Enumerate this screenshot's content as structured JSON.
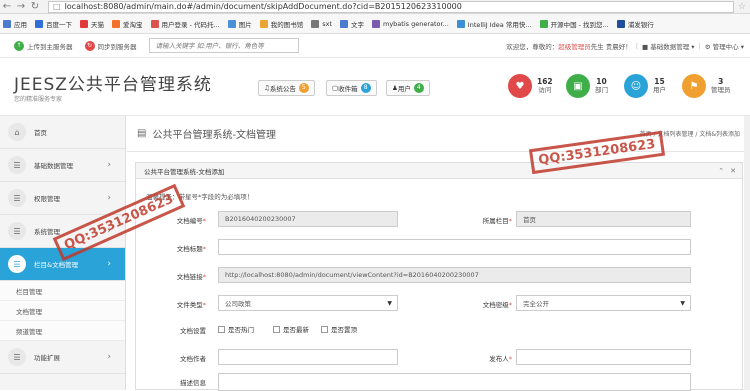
{
  "browser": {
    "url": "localhost:8080/admin/main.do#/admin/document/skipAddDocument.do?cid=B2015120623310000",
    "bookmarks": [
      {
        "label": "应用",
        "color": "#4a7bd0"
      },
      {
        "label": "百度一下",
        "color": "#2f6fd6"
      },
      {
        "label": "天猫",
        "color": "#e23a3a"
      },
      {
        "label": "爱淘宝",
        "color": "#f2722b"
      },
      {
        "label": "用户登录 - 代码托...",
        "color": "#d9534f"
      },
      {
        "label": "图片",
        "color": "#4a90d9"
      },
      {
        "label": "我的图书馆",
        "color": "#e8a533"
      },
      {
        "label": "sxt",
        "color": "#777777"
      },
      {
        "label": "文字",
        "color": "#4a7bd0"
      },
      {
        "label": "mybatis generator...",
        "color": "#7b5bb0"
      },
      {
        "label": "IntelliJ Idea 常用快...",
        "color": "#3b8fd6"
      },
      {
        "label": "开源中国 - 找到您...",
        "color": "#3fae49"
      },
      {
        "label": "浦发银行",
        "color": "#1d4f9c"
      }
    ]
  },
  "topbar": {
    "upload_label": "上传到主服务器",
    "sync_label": "同步到服务器",
    "search_placeholder": "请输入关键字 如:用户、银行、角色等",
    "welcome_prefix": "欢迎您，尊敬的：",
    "admin_name": "超级管理员",
    "welcome_suffix": "先生 贵晨好！",
    "basic_mgmt": "基础数据管理",
    "mgmt_center": "管理中心"
  },
  "header": {
    "logo": "JEESZ公共平台管理系统",
    "subtitle": "您的精准服务专家",
    "notice_label": "系统公告",
    "notice_count": "5",
    "inbox_label": "收件箱",
    "inbox_count": "8",
    "user_label": "用户",
    "user_count": "4",
    "stats": [
      {
        "value": "162",
        "label": "访问",
        "color": "#e0484a",
        "icon": "activity-icon"
      },
      {
        "value": "10",
        "label": "部门",
        "color": "#3fae49",
        "icon": "money-icon"
      },
      {
        "value": "15",
        "label": "用户",
        "color": "#2aa3d9",
        "icon": "users-icon"
      },
      {
        "value": "3",
        "label": "管理员",
        "color": "#f0a030",
        "icon": "admin-icon"
      }
    ]
  },
  "sidebar": {
    "items": [
      {
        "label": "首页"
      },
      {
        "label": "基础数据管理"
      },
      {
        "label": "权限管理"
      },
      {
        "label": "系统管理"
      },
      {
        "label": "栏目&文档管理"
      }
    ],
    "subitems": [
      "栏目管理",
      "文档管理",
      "频道管理"
    ],
    "last_item": "功能扩展"
  },
  "main": {
    "page_title": "公共平台管理系统-文档管理",
    "breadcrumb": "首页 / 文档列表管理 / 文档&列表添加",
    "panel_title": "公共平台管理系统-文档添加",
    "hint": "温馨提示：带星号*字段的为必填项！",
    "form": {
      "doc_no_label": "文档编号",
      "doc_no_value": "B2016040200230007",
      "column_label": "所属栏目",
      "column_value": "首页",
      "title_label": "文档标题",
      "link_label": "文档链接",
      "link_value": "http://localhost:8080/admin/document/viewContent?id=B2016040200230007",
      "type_label": "文件类型",
      "type_value": "公司政策",
      "secret_label": "文档密级",
      "secret_value": "完全公开",
      "settings_label": "文档设置",
      "opt_hot": "是否热门",
      "opt_new": "是否最新",
      "opt_top": "是否置顶",
      "author_label": "文档作者",
      "publisher_label": "发布人",
      "summary_label": "描述信息"
    }
  },
  "watermark": "QQ:3531208623"
}
